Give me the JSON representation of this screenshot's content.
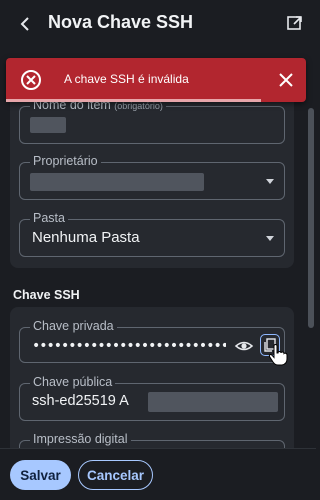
{
  "header": {
    "title": "Nova Chave SSH",
    "back_icon": "chevron-left-icon",
    "popout_icon": "popout-window-icon"
  },
  "toast": {
    "message": "A chave SSH é inválida",
    "icon": "error-circle-icon",
    "close_icon": "close-icon",
    "color": "#b2262f",
    "progress": 0.85
  },
  "item_details": {
    "name_label": "Nome do item",
    "name_required": "(obrigatório)",
    "owner_label": "Proprietário",
    "folder_label": "Pasta",
    "folder_value": "Nenhuma Pasta"
  },
  "ssh_section": {
    "heading": "Chave SSH",
    "private_key_label": "Chave privada",
    "private_key_masked": "••••••••••••••••••••••••••••••••••••••••",
    "public_key_label": "Chave pública",
    "public_key_value": "ssh-ed25519 A",
    "fingerprint_label": "Impressão digital"
  },
  "footer": {
    "save_label": "Salvar",
    "cancel_label": "Cancelar"
  },
  "colors": {
    "accent": "#a7c8ff",
    "background": "#1b1d22",
    "card": "#26292f",
    "error": "#b2262f"
  }
}
